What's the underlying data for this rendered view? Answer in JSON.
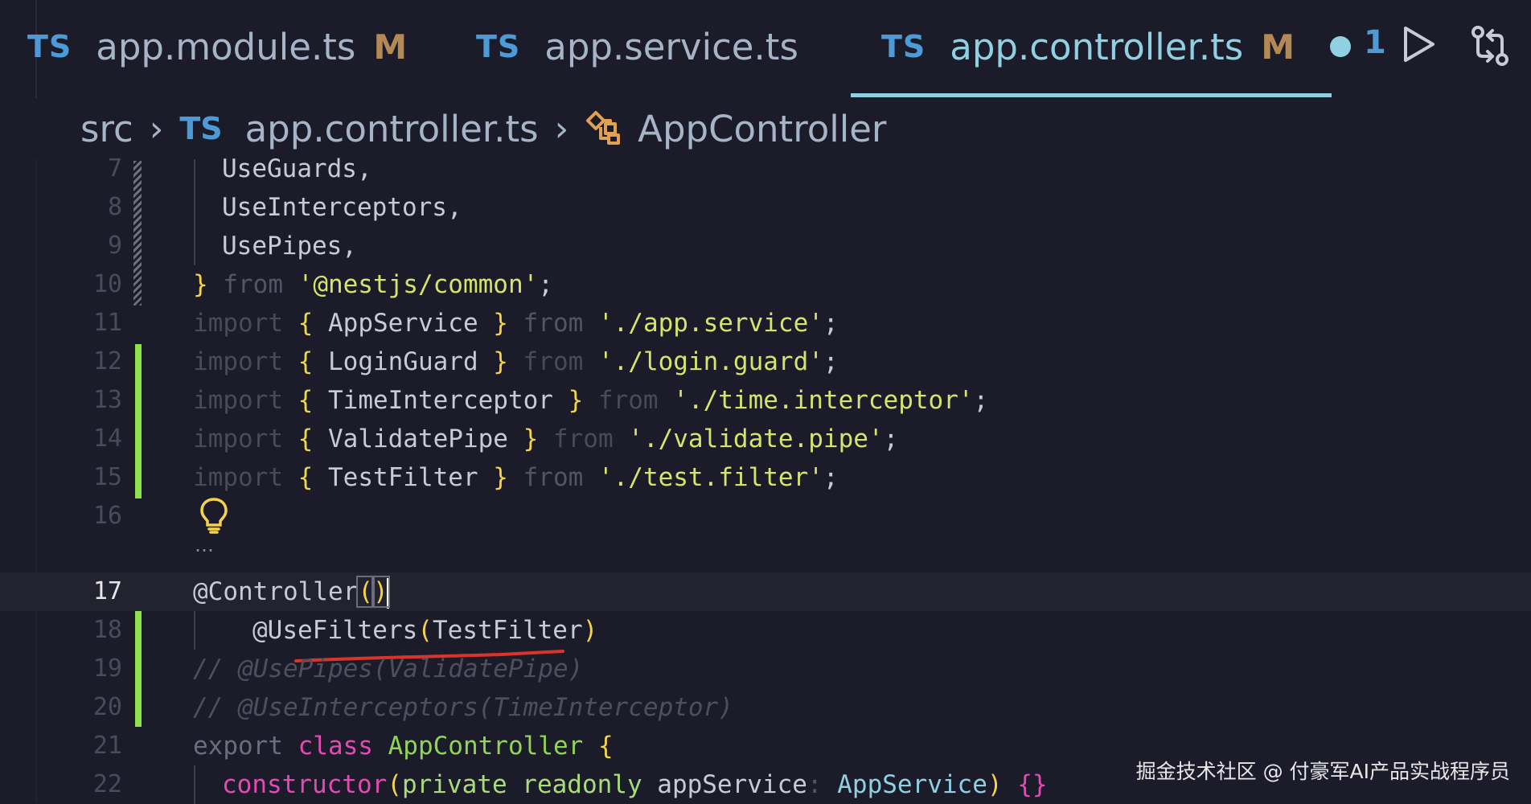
{
  "tabs": [
    {
      "badge": "TS",
      "name": "app.module.ts",
      "status": "M"
    },
    {
      "badge": "TS",
      "name": "app.service.ts",
      "status": ""
    },
    {
      "badge": "TS",
      "name": "app.controller.ts",
      "status": "M",
      "dirty": true,
      "active": true
    }
  ],
  "tab_overflow": "1",
  "toolbar": {
    "run_icon": "play-icon",
    "compare_icon": "git-compare-icon"
  },
  "breadcrumb": {
    "folder": "src",
    "file_badge": "TS",
    "file": "app.controller.ts",
    "symbol_icon": "class-icon",
    "symbol": "AppController"
  },
  "editor": {
    "current_line": "17",
    "lines": [
      {
        "n": "7",
        "text": "UseGuards,"
      },
      {
        "n": "8",
        "text": "UseInterceptors,"
      },
      {
        "n": "9",
        "text": "UsePipes,"
      },
      {
        "n": "10",
        "t1": "}",
        "t2": " from ",
        "t3": "'@nestjs/common'",
        "t4": ";"
      },
      {
        "n": "11",
        "a": "import ",
        "b": "{",
        "c": " AppService ",
        "d": "}",
        "e": " from ",
        "f": "'./app.service'",
        "g": ";"
      },
      {
        "n": "12",
        "a": "import ",
        "b": "{",
        "c": " LoginGuard ",
        "d": "}",
        "e": " from ",
        "f": "'./login.guard'",
        "g": ";"
      },
      {
        "n": "13",
        "a": "import ",
        "b": "{",
        "c": " TimeInterceptor ",
        "d": "}",
        "e": " from ",
        "f": "'./time.interceptor'",
        "g": ";"
      },
      {
        "n": "14",
        "a": "import ",
        "b": "{",
        "c": " ValidatePipe ",
        "d": "}",
        "e": " from ",
        "f": "'./validate.pipe'",
        "g": ";"
      },
      {
        "n": "15",
        "a": "import ",
        "b": "{",
        "c": " TestFilter ",
        "d": "}",
        "e": " from ",
        "f": "'./test.filter'",
        "g": ";"
      },
      {
        "n": "16",
        "lightbulb": "lightbulb-icon",
        "ellipsis": "…"
      },
      {
        "n": "17",
        "deco": "@Controller",
        "open": "(",
        "close": ")"
      },
      {
        "n": "18",
        "deco": "@UseFilters",
        "open": "(",
        "arg": "TestFilter",
        "close": ")"
      },
      {
        "n": "19",
        "comment": "// @UsePipes(ValidatePipe)"
      },
      {
        "n": "20",
        "comment": "// @UseInterceptors(TimeInterceptor)"
      },
      {
        "n": "21",
        "k1": "export ",
        "k2": "class ",
        "cls": "AppController ",
        "brace": "{"
      },
      {
        "n": "22",
        "ctor": "constructor",
        "p1": "(",
        "m1": "private ",
        "m2": "readonly ",
        "param": "appService",
        "colon": ": ",
        "type": "AppService",
        "p2": ")",
        "sp": " ",
        "body": "{}"
      }
    ]
  },
  "annotation_color": "#d9342b",
  "watermark": "掘金技术社区 @ 付豪军AI产品实战程序员"
}
